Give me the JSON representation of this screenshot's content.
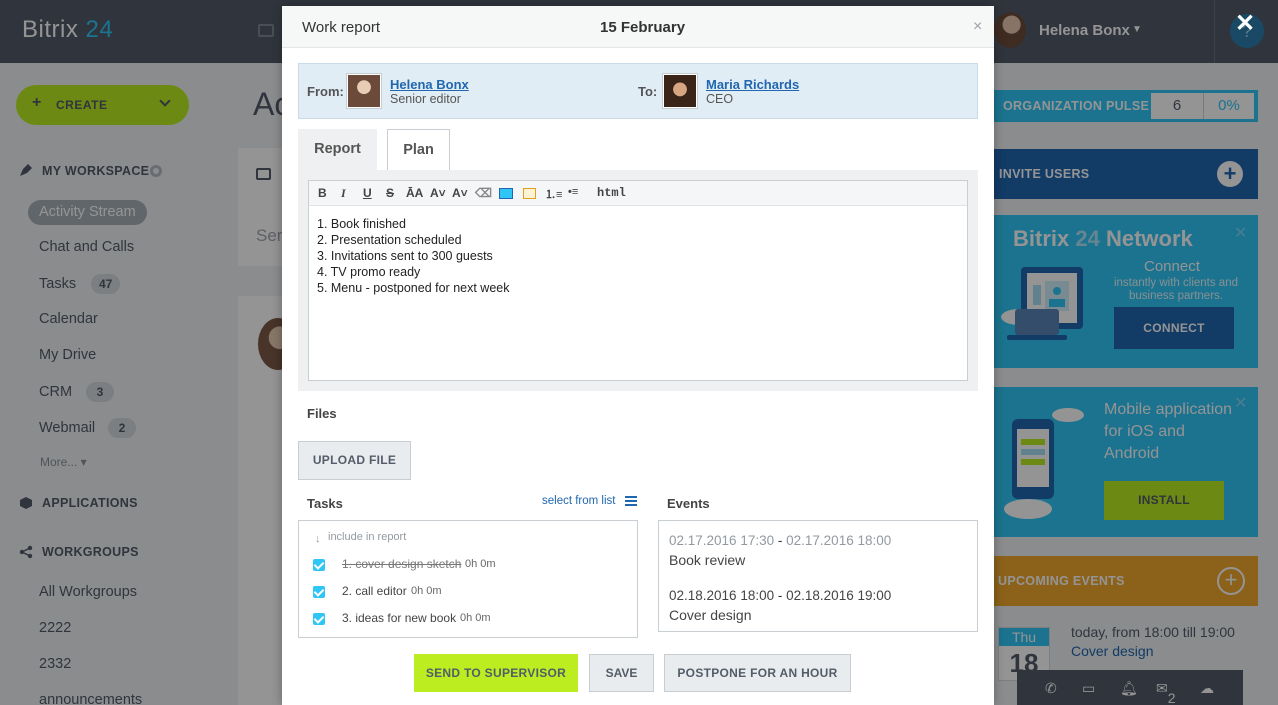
{
  "header": {
    "logo_name": "Bitrix",
    "logo_num": "24",
    "user_name": "Helena Bonx",
    "help": "?"
  },
  "sidebar": {
    "create_label": "CREATE",
    "workspace_title": "MY WORKSPACE",
    "items": [
      {
        "label": "Activity Stream"
      },
      {
        "label": "Chat and Calls"
      },
      {
        "label": "Tasks",
        "count": "47"
      },
      {
        "label": "Calendar"
      },
      {
        "label": "My Drive"
      },
      {
        "label": "CRM",
        "count": "3"
      },
      {
        "label": "Webmail",
        "count": "2"
      }
    ],
    "more": "More...",
    "applications_title": "APPLICATIONS",
    "workgroups_title": "WORKGROUPS",
    "workgroups": [
      "All Workgroups",
      "2222",
      "2332",
      "announcements"
    ]
  },
  "center": {
    "title_fragment": "Ac",
    "search_fragment": "Ser"
  },
  "right": {
    "pulse_label": "ORGANIZATION PULSE",
    "pulse_value": "6",
    "pulse_percent": "0%",
    "invite_label": "INVITE USERS",
    "network_title": "Bitrix",
    "network_num": "24",
    "network_word": "Network",
    "network_connect": "Connect",
    "network_sub": "instantly with clients and business partners.",
    "network_btn": "CONNECT",
    "mobile_l1": "Mobile application",
    "mobile_l2": "for iOS and",
    "mobile_l3": "Android",
    "mobile_btn": "INSTALL",
    "upcoming_label": "UPCOMING EVENTS",
    "event_day": "Thu",
    "event_date": "18",
    "event_when": "today, from 18:00 till 19:00",
    "event_name": "Cover design"
  },
  "bottom_toolbar": {
    "mail_count": "2"
  },
  "modal": {
    "title": "Work report",
    "date": "15 February",
    "from_label": "From:",
    "from_name": "Helena Bonx",
    "from_role": "Senior editor",
    "to_label": "To:",
    "to_name": "Maria Richards",
    "to_role": "CEO",
    "tabs": [
      "Report",
      "Plan"
    ],
    "editor_html_label": "html",
    "editor_lines": [
      "1. Book finished",
      "2. Presentation scheduled",
      "3. Invitations sent to 300 guests",
      "4. TV promo ready",
      "5. Menu - postponed for next week"
    ],
    "files_label": "Files",
    "upload_label": "UPLOAD FILE",
    "tasks_label": "Tasks",
    "select_from_list": "select from list",
    "include_in_report": "include in report",
    "tasks": [
      {
        "title": "1. cover design sketch",
        "time": "0h 0m",
        "checked": true,
        "strike": true
      },
      {
        "title": "2. call editor",
        "time": "0h 0m",
        "checked": true,
        "strike": false
      },
      {
        "title": "3. ideas for new book",
        "time": "0h 0m",
        "checked": true,
        "strike": false
      }
    ],
    "events_label": "Events",
    "events": [
      {
        "from": "02.17.2016 17:30",
        "to": "02.17.2016 18:00",
        "name": "Book review"
      },
      {
        "from": "02.18.2016 18:00",
        "to": "02.18.2016 19:00",
        "name": "Cover design"
      }
    ],
    "send_label": "SEND TO SUPERVISOR",
    "save_label": "SAVE",
    "postpone_label": "POSTPONE FOR AN HOUR"
  },
  "colors": {
    "accent_green": "#bbed21",
    "accent_blue": "#2fc6f6",
    "dark_blue": "#2067b0",
    "orange": "#f2a92e",
    "header": "#535c69"
  }
}
